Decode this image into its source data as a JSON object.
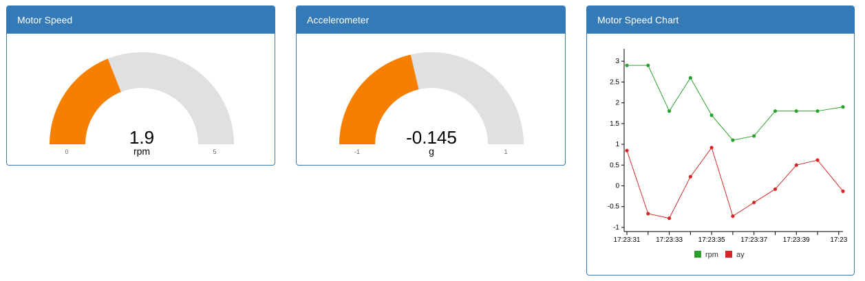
{
  "panels": {
    "motor_speed": {
      "title": "Motor Speed",
      "value": 1.9,
      "value_text": "1.9",
      "unit": "rpm",
      "min": 0,
      "max": 5,
      "min_label": "0",
      "max_label": "5"
    },
    "accelerometer": {
      "title": "Accelerometer",
      "value": -0.145,
      "value_text": "-0.145",
      "unit": "g",
      "min": -1,
      "max": 1,
      "min_label": "-1",
      "max_label": "1"
    },
    "chart": {
      "title": "Motor Speed Chart"
    }
  },
  "colors": {
    "header_bg": "#337ab7",
    "gauge_fill": "#f77f00",
    "gauge_track": "#e0e0e0",
    "rpm_series": "#2ca02c",
    "ay_series": "#d62728"
  },
  "chart_data": {
    "type": "line",
    "x_tick_labels": [
      "17:23:31",
      "17:23:33",
      "17:23:35",
      "17:23:37",
      "17:23:39",
      "17:23"
    ],
    "x_tick_index_positions": [
      0,
      2,
      4,
      6,
      8,
      10
    ],
    "ylim": [
      -1.1,
      3.3
    ],
    "y_ticks": [
      3,
      2.5,
      2,
      1.5,
      1,
      0.5,
      0,
      -0.5,
      -1
    ],
    "y_tick_labels": [
      "3",
      "2.5",
      "2",
      "1.5",
      "1",
      "0.5",
      "0",
      "-0.5",
      "-1"
    ],
    "xlim": [
      0,
      10.2
    ],
    "legend": "bottom",
    "series": [
      {
        "name": "rpm",
        "color": "#2ca02c",
        "x": [
          0,
          1,
          2,
          3,
          4,
          5,
          6,
          7,
          8,
          9,
          10.2
        ],
        "values": [
          2.9,
          2.9,
          1.8,
          2.6,
          1.7,
          1.1,
          1.2,
          1.8,
          1.8,
          1.8,
          1.9
        ]
      },
      {
        "name": "ay",
        "color": "#d62728",
        "x": [
          0,
          1,
          2,
          3,
          4,
          5,
          6,
          7,
          8,
          9,
          10.2
        ],
        "values": [
          0.85,
          -0.67,
          -0.78,
          0.22,
          0.92,
          -0.73,
          -0.4,
          -0.08,
          0.5,
          0.62,
          -0.13
        ]
      }
    ]
  }
}
